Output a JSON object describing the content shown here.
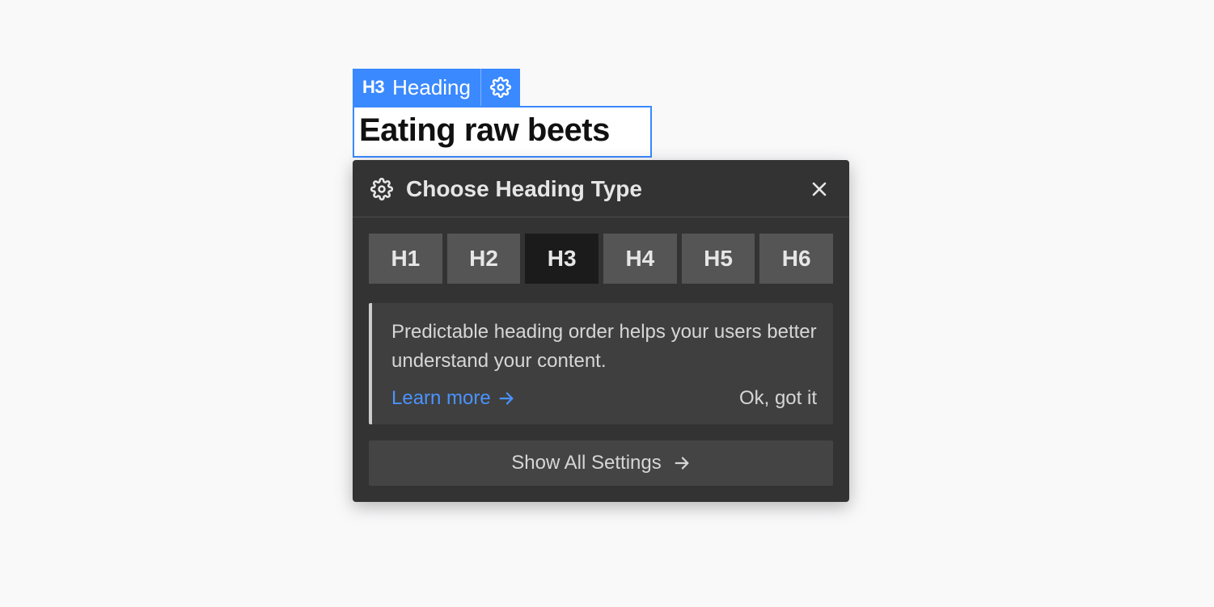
{
  "block_tag": {
    "icon_text": "H3",
    "label": "Heading"
  },
  "heading_content": "Eating raw beets",
  "panel": {
    "title": "Choose Heading Type",
    "levels": [
      "H1",
      "H2",
      "H3",
      "H4",
      "H5",
      "H6"
    ],
    "active_level": "H3",
    "tip": {
      "text": "Predictable heading order helps your users better understand your content.",
      "learn_more": "Learn more",
      "dismiss": "Ok, got it"
    },
    "show_all": "Show All Settings"
  }
}
